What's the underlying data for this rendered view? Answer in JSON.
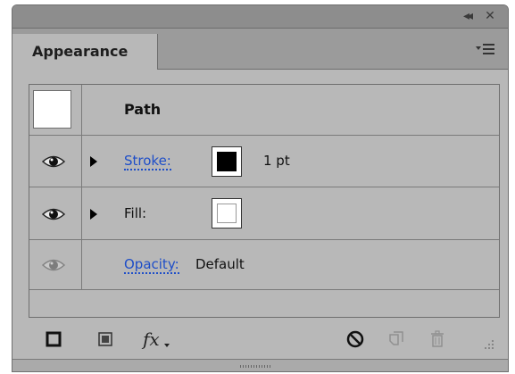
{
  "titlebar": {
    "collapse_glyph": "◂◂",
    "close_glyph": "✕"
  },
  "tab": {
    "label": "Appearance",
    "menu_icon": "panel-menu-icon"
  },
  "object_row": {
    "label": "Path"
  },
  "stroke_row": {
    "label": "Stroke:",
    "swatch_color": "#000000",
    "value": "1 pt"
  },
  "fill_row": {
    "label": "Fill:",
    "swatch_color": "#ffffff"
  },
  "opacity_row": {
    "label": "Opacity:",
    "value": "Default"
  },
  "bottom_toolbar": {
    "icons": [
      "add-new-stroke-icon",
      "add-new-fill-icon",
      "add-new-effect-icon",
      "clear-appearance-icon",
      "duplicate-item-icon",
      "delete-item-icon"
    ],
    "fx_label": "fx"
  },
  "colors": {
    "panel_bg": "#b8b8b8",
    "link_blue": "#1e4ec8"
  }
}
